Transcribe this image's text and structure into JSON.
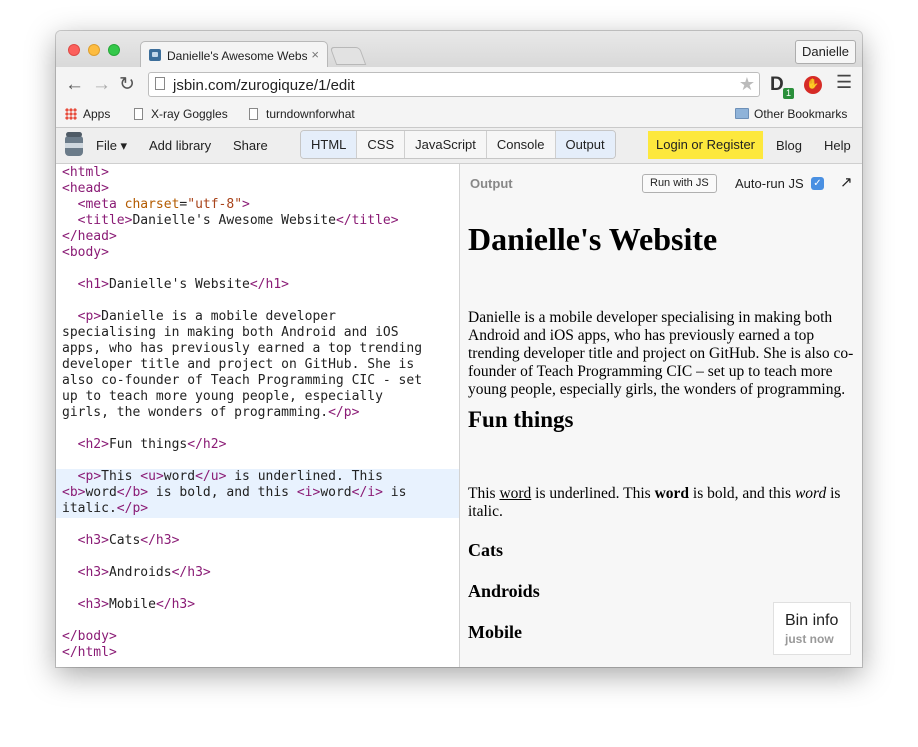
{
  "browser": {
    "tab_title": "Danielle's Awesome Websi",
    "tab_close": "×",
    "profile_name": "Danielle",
    "url": "jsbin.com/zurogiquze/1/edit",
    "bookmarks": [
      "Apps",
      "X-ray Goggles",
      "turndownforwhat"
    ],
    "other_bookmarks": "Other Bookmarks",
    "ext_badge": "1"
  },
  "jsbin": {
    "menu": {
      "file": "File ▾",
      "add_library": "Add library",
      "share": "Share"
    },
    "panels": [
      "HTML",
      "CSS",
      "JavaScript",
      "Console",
      "Output"
    ],
    "login": "Login or Register",
    "blog": "Blog",
    "help": "Help"
  },
  "editor": {
    "lines": [
      "<html>",
      "<head>",
      "  <meta charset=\"utf-8\">",
      "  <title>Danielle's Awesome Website</title>",
      "</head>",
      "<body>",
      "",
      "  <h1>Danielle's Website</h1>",
      "",
      "  <p>Danielle is a mobile developer",
      "specialising in making both Android and iOS",
      "apps, who has previously earned a top trending",
      "developer title and project on GitHub. She is",
      "also co-founder of Teach Programming CIC - set",
      "up to teach more young people, especially",
      "girls, the wonders of programming.</p>",
      "",
      "  <h2>Fun things</h2>",
      "",
      "  <p>This <u>word</u> is underlined. This",
      "<b>word</b> is bold, and this <i>word</i> is",
      "italic.</p>",
      "",
      "  <h3>Cats</h3>",
      "",
      "  <h3>Androids</h3>",
      "",
      "  <h3>Mobile</h3>",
      "",
      "</body>",
      "</html>"
    ]
  },
  "output": {
    "label": "Output",
    "run_button": "Run with JS",
    "autorun_label": "Auto-run JS",
    "h1": "Danielle's Website",
    "p1": "Danielle is a mobile developer specialising in making both Android and iOS apps, who has previously earned a top trending developer title and project on GitHub. She is also co-founder of Teach Programming CIC – set up to teach more young people, especially girls, the wonders of programming.",
    "h2": "Fun things",
    "p2": {
      "t1": "This ",
      "u": "word",
      "t2": " is underlined. This ",
      "b": "word",
      "t3": " is bold, and this ",
      "i": "word",
      "t4": " is italic."
    },
    "h3": [
      "Cats",
      "Androids",
      "Mobile"
    ]
  },
  "bin_info": {
    "title": "Bin info",
    "time": "just now"
  }
}
